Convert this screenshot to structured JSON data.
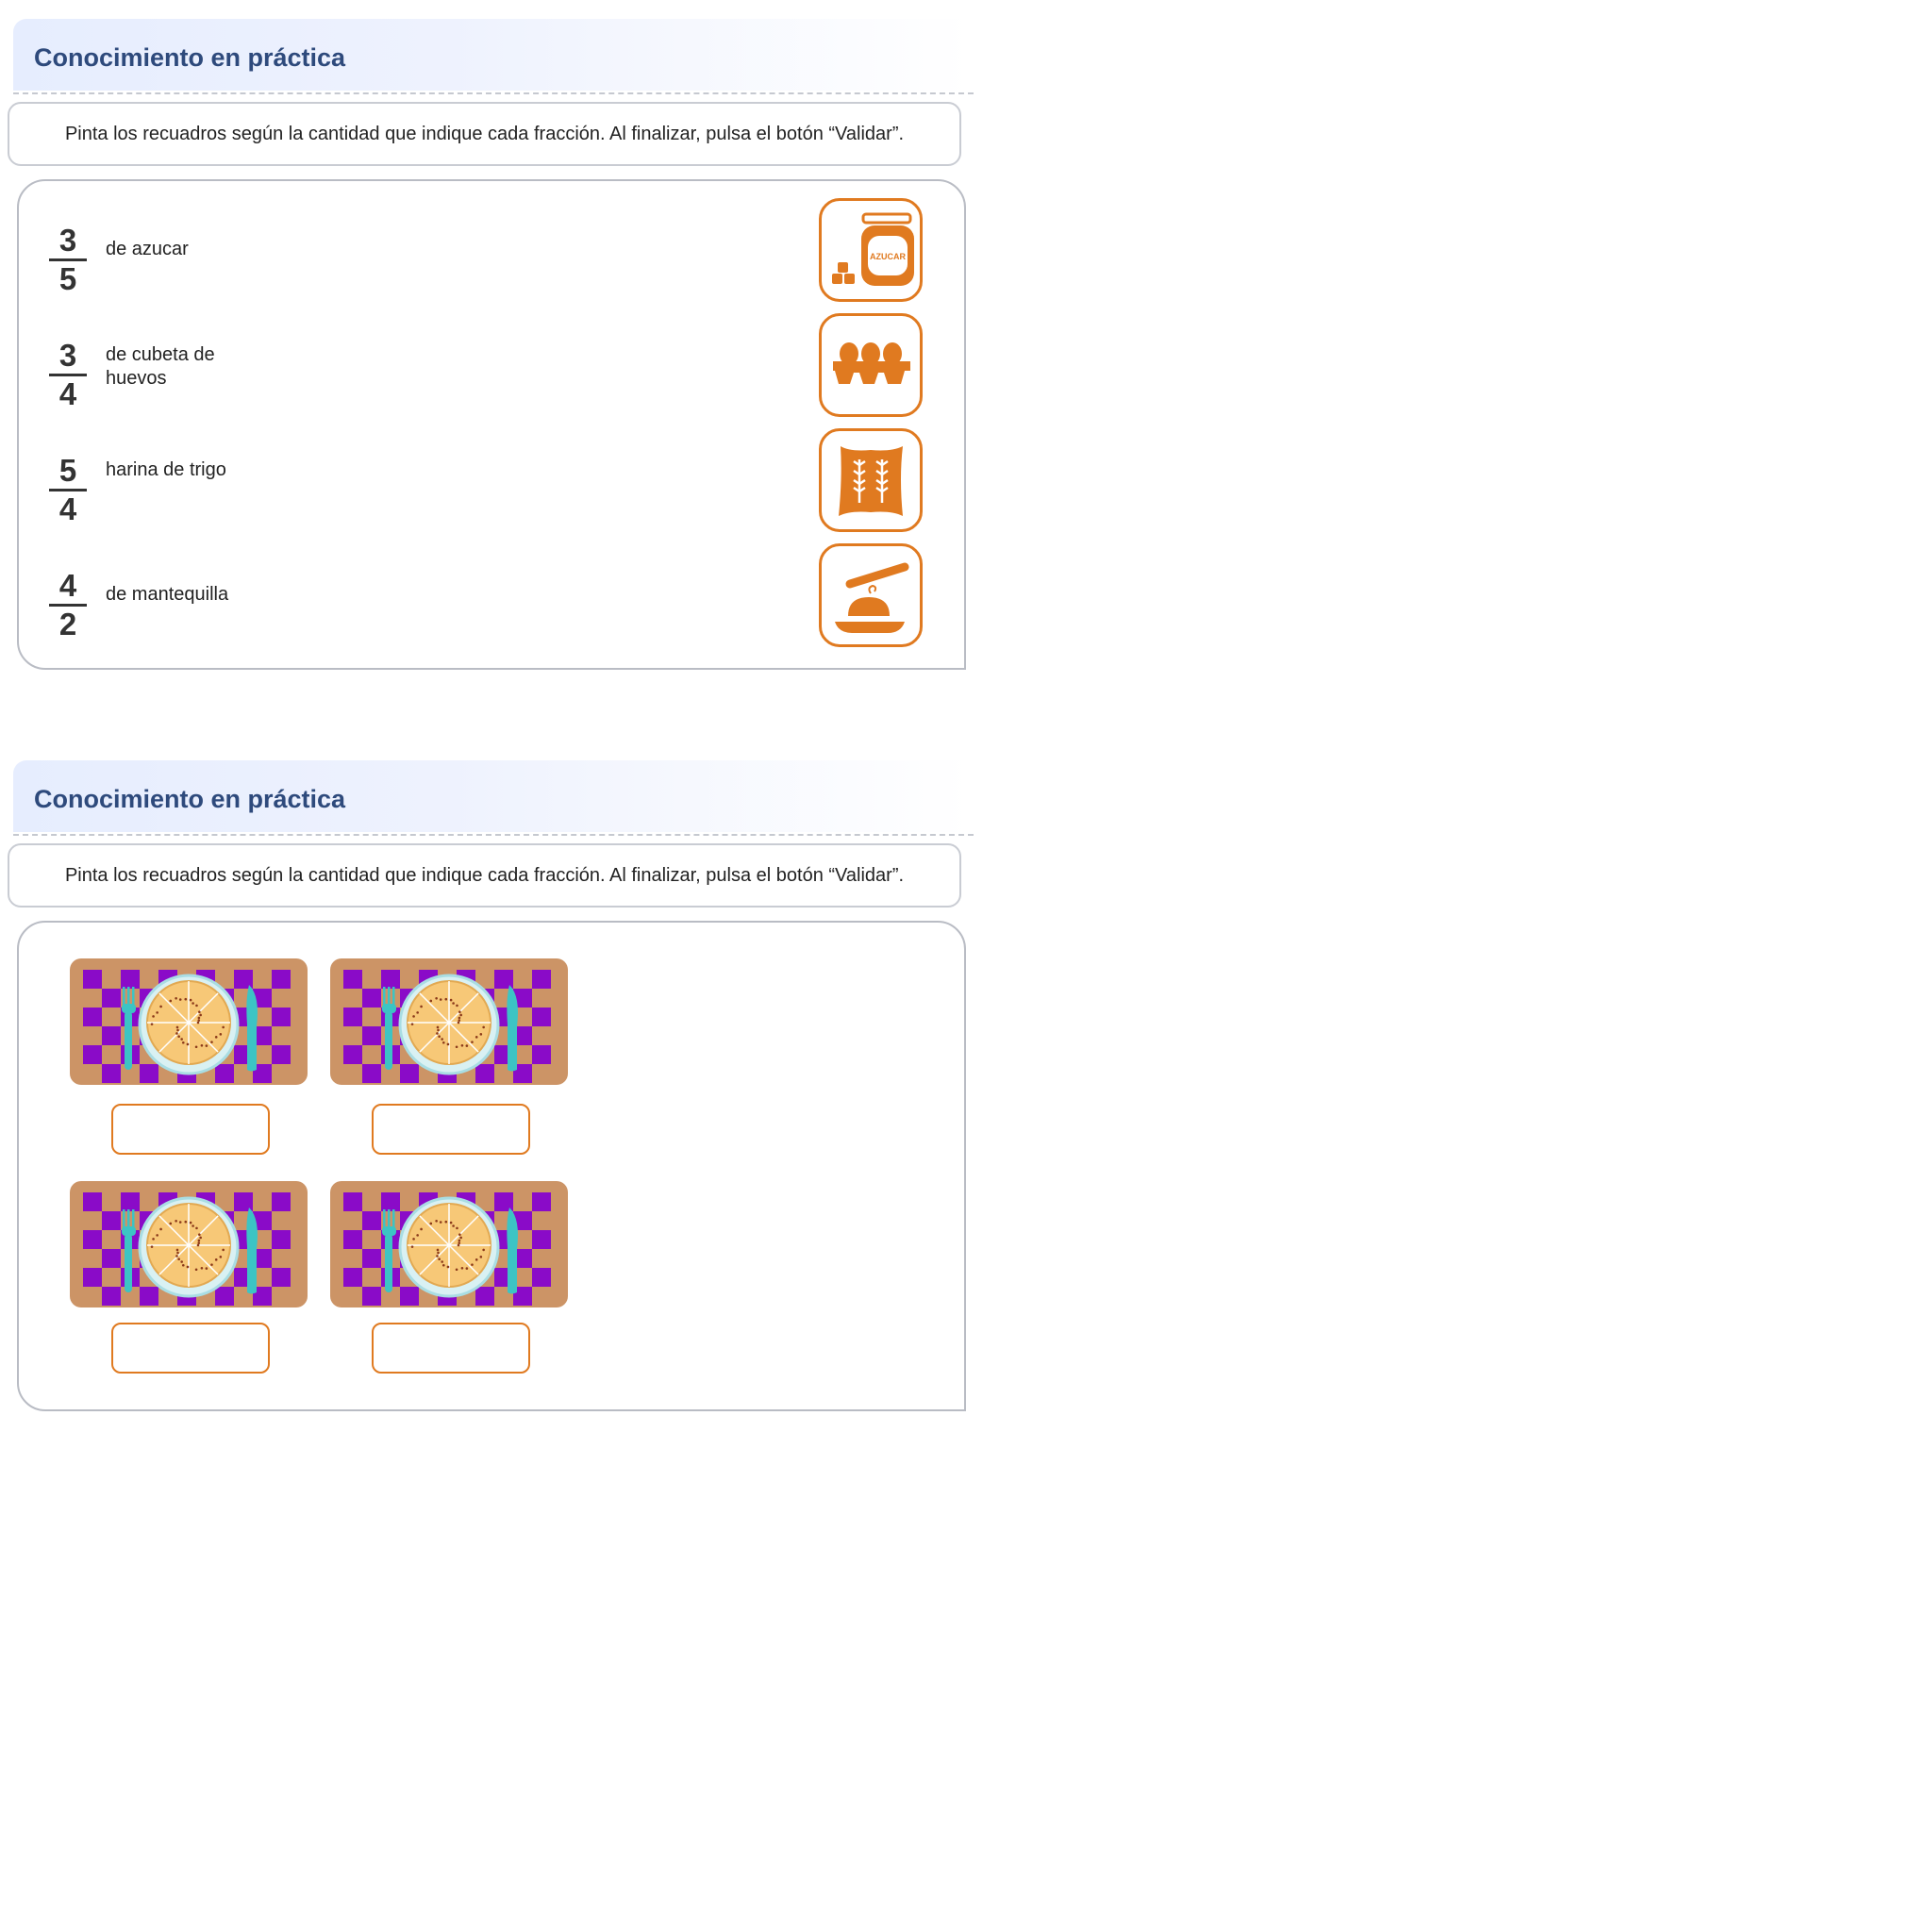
{
  "exercise1": {
    "title": "Conocimiento en práctica",
    "instruction": "Pinta los recuadros según la cantidad que indique cada fracción. Al finalizar, pulsa el botón “Validar”.",
    "items": [
      {
        "numerator": "3",
        "denominator": "5",
        "label": "de azucar",
        "icon": "sugar-jar-icon",
        "jar_text": "AZUCAR"
      },
      {
        "numerator": "3",
        "denominator": "4",
        "label": "de cubeta de huevos",
        "icon": "egg-carton-icon"
      },
      {
        "numerator": "5",
        "denominator": "4",
        "label": "harina de trigo",
        "icon": "flour-sack-icon"
      },
      {
        "numerator": "4",
        "denominator": "2",
        "label": "de mantequilla",
        "icon": "butter-dish-icon"
      }
    ],
    "icon_color": "#e07a20"
  },
  "exercise2": {
    "title": "Conocimiento en práctica",
    "instruction": "Pinta los recuadros según la cantidad que indique cada fracción. Al finalizar, pulsa el botón “Validar”.",
    "cards": [
      {
        "icon": "pizza-placemat-icon",
        "answer_value": ""
      },
      {
        "icon": "pizza-placemat-icon",
        "answer_value": ""
      },
      {
        "icon": "pizza-placemat-icon",
        "answer_value": ""
      },
      {
        "icon": "pizza-placemat-icon",
        "answer_value": ""
      }
    ],
    "colors": {
      "placemat": "#cc9466",
      "checker": "#8a0bc8",
      "cutlery": "#3cc4c4",
      "pizza": "#f7c877",
      "accent": "#e07a20"
    }
  }
}
